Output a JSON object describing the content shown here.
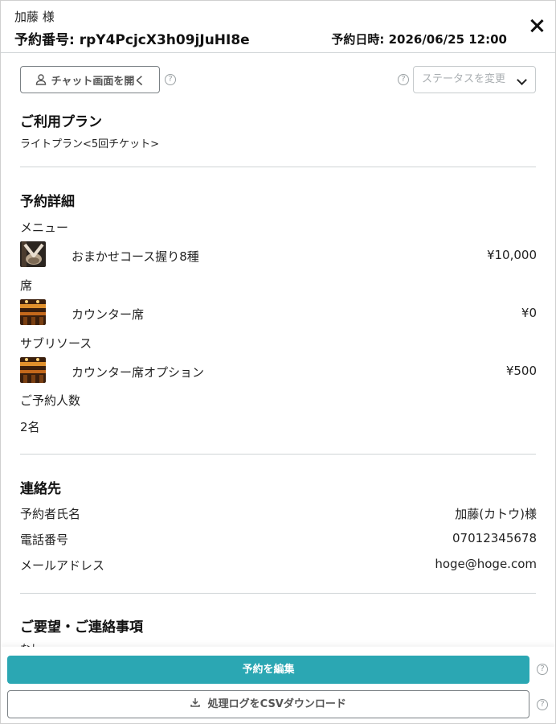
{
  "header": {
    "customer_name": "加藤 様",
    "reservation_number": "予約番号: rpY4PcjcX3h09jJuHI8e",
    "reservation_datetime": "予約日時: 2026/06/25 12:00",
    "close_icon": "close-icon"
  },
  "toolbar": {
    "chat_label": "チャット画面を開く",
    "chat_icon": "person-icon",
    "help_glyph": "?",
    "status_placeholder": "ステータスを変更"
  },
  "plan": {
    "title": "ご利用プラン",
    "value": "ライトプラン<5回チケット>"
  },
  "details": {
    "title": "予約詳細",
    "menu_label": "メニュー",
    "menu_item": {
      "name": "おまかせコース握り8種",
      "price": "¥10,000"
    },
    "seat_label": "席",
    "seat_item": {
      "name": "カウンター席",
      "price": "¥0"
    },
    "sub_label": "サブリソース",
    "sub_item": {
      "name": "カウンター席オプション",
      "price": "¥500"
    },
    "party_label": "ご予約人数",
    "party_value": "2名"
  },
  "contact": {
    "title": "連絡先",
    "rows": [
      {
        "label": "予約者氏名",
        "value": "加藤(カトウ)様"
      },
      {
        "label": "電話番号",
        "value": "07012345678"
      },
      {
        "label": "メールアドレス",
        "value": "hoge@hoge.com"
      }
    ]
  },
  "requests": {
    "title": "ご要望・ご連絡事項",
    "value": "なし"
  },
  "footer": {
    "edit_label": "予約を編集",
    "csv_label": "処理ログをCSVダウンロード",
    "download_icon": "download-icon"
  },
  "colors": {
    "accent": "#2ba7b3",
    "divider": "#cfd4d6"
  }
}
